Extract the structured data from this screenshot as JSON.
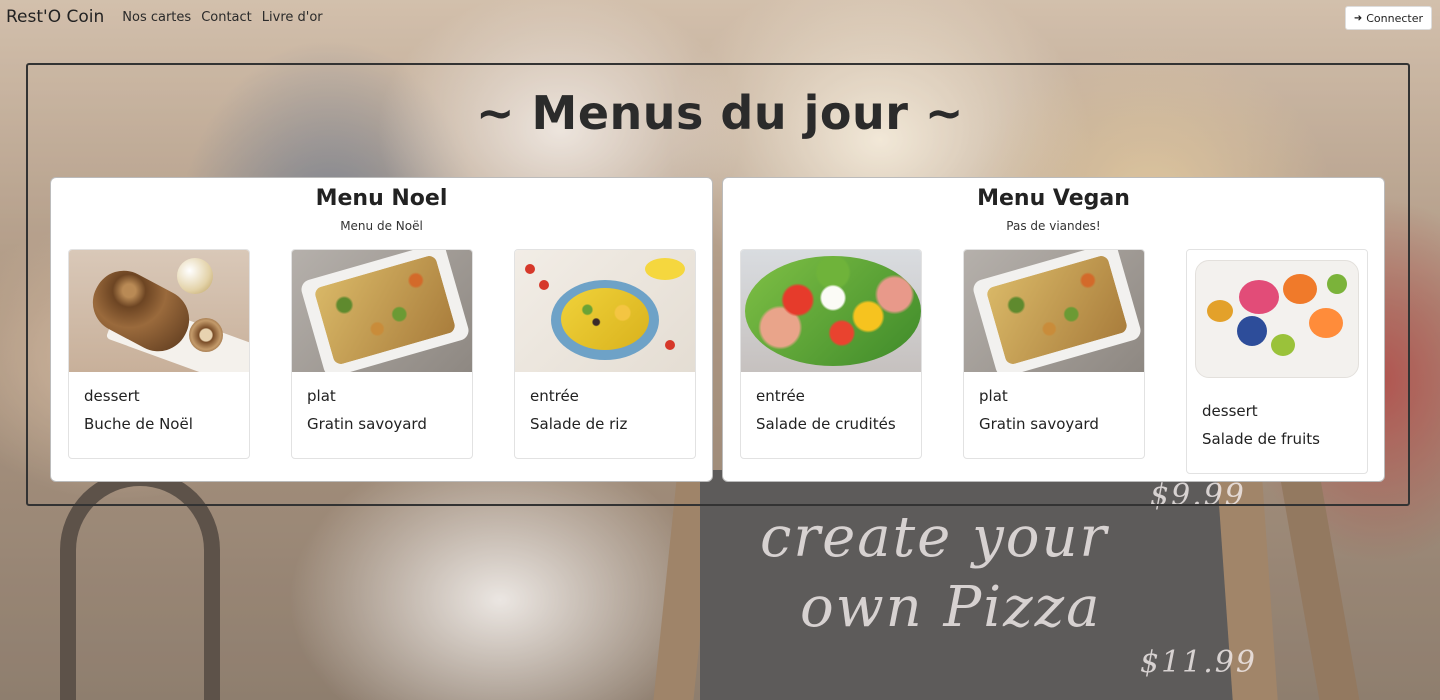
{
  "navbar": {
    "brand": "Rest'O Coin",
    "links": [
      "Nos cartes",
      "Contact",
      "Livre d'or"
    ],
    "connect_label": "Connecter"
  },
  "page": {
    "title": "~ Menus du jour ~"
  },
  "menus": [
    {
      "title": "Menu Noel",
      "subtitle": "Menu de Noël",
      "dishes": [
        {
          "category": "dessert",
          "name": "Buche de Noël",
          "image": "buche-de-noel-photo"
        },
        {
          "category": "plat",
          "name": "Gratin savoyard",
          "image": "gratin-photo"
        },
        {
          "category": "entrée",
          "name": "Salade de riz",
          "image": "salade-de-riz-photo"
        }
      ]
    },
    {
      "title": "Menu Vegan",
      "subtitle": "Pas de viandes!",
      "dishes": [
        {
          "category": "entrée",
          "name": "Salade de crudités",
          "image": "salade-crudites-photo"
        },
        {
          "category": "plat",
          "name": "Gratin savoyard",
          "image": "gratin-photo"
        },
        {
          "category": "dessert",
          "name": "Salade de fruits",
          "image": "salade-de-fruits-photo"
        }
      ]
    }
  ],
  "background": {
    "chalkboard_lines": [
      "create your",
      "own Pizza"
    ],
    "chalkboard_prices": [
      "$9.99",
      "$11.99"
    ]
  },
  "colors": {
    "text": "#222222",
    "frame_border": "#333333",
    "card_bg": "#ffffff"
  }
}
